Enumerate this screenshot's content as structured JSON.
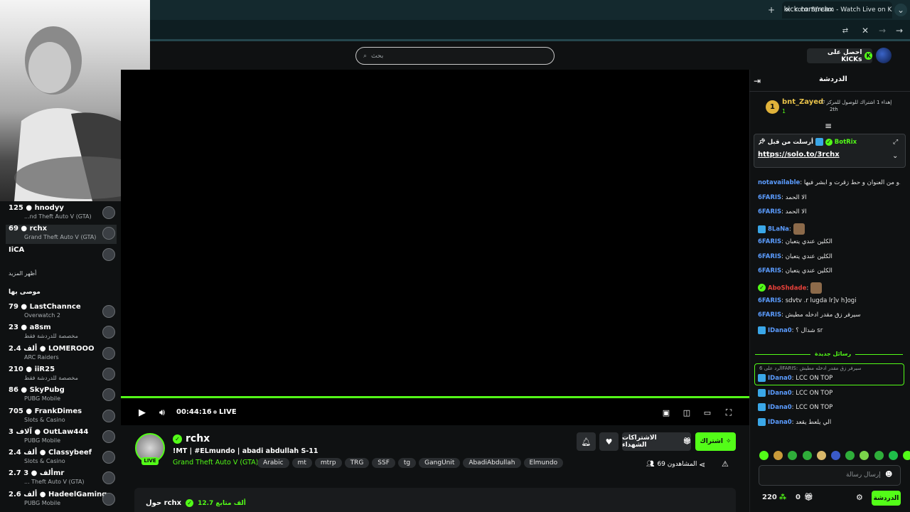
{
  "browser": {
    "tab_title": "rchx Stream - Watch Live on Kick",
    "url": "kick.com/rchx"
  },
  "header": {
    "search_placeholder": "بحث",
    "kicks_label": "احصل على KICKs"
  },
  "sidebar": {
    "channels": [
      {
        "name": "125 ● hnodyy",
        "game": "...nd Theft Auto V (GTA)"
      },
      {
        "name": "69 ● rchx",
        "game": "Grand Theft Auto V (GTA)"
      },
      {
        "name": "IiCA",
        "game": ""
      }
    ],
    "show_more": "أظهر المزيد",
    "recommended_title": "موصى بها",
    "recommended": [
      {
        "name": "79 ● LastChannce",
        "game": "Overwatch 2"
      },
      {
        "name": "23 ● a8sm",
        "game": "مخصصة للدردشة فقط"
      },
      {
        "name": "2.4 ألف ● LOMEROOO",
        "game": "ARC Raiders"
      },
      {
        "name": "210 ● iiR25",
        "game": "مخصصة للدردشة فقط"
      },
      {
        "name": "86 ● SkyPubg",
        "game": "PUBG Mobile"
      },
      {
        "name": "705 ● FrankDimes",
        "game": "Slots & Casino"
      },
      {
        "name": "3 آلاف ● OutLaw444",
        "game": "PUBG Mobile"
      },
      {
        "name": "2.4 ألف ● Classybeef",
        "game": "Slots & Casino"
      },
      {
        "name": "2.7 ألف ● 3mr",
        "game": "... Theft Auto V (GTA)"
      },
      {
        "name": "2.6 ألف ● HadeelGaming",
        "game": "PUBG Mobile"
      }
    ]
  },
  "player": {
    "time": "00:44:16",
    "live_label": "LIVE"
  },
  "stream": {
    "channel": "rchx",
    "title": "!MT | #ELmundo | abadi abdullah S-11",
    "game": "Grand Theft Auto V (GTA)",
    "tags": [
      "Arabic",
      "mt",
      "mtrp",
      "TRG",
      "SSF",
      "tg",
      "GangUnit",
      "AbadiAbdullah",
      "Elmundo"
    ],
    "live_badge": "LIVE",
    "subscribe_label": "اشتراك",
    "gift_label": "الاشتراكات الشهداء",
    "viewers": "69 المشاهدون",
    "about_title": "حول rchx",
    "followers": "12.7 ألف متابع"
  },
  "chat": {
    "title": "الدردشة",
    "top_gifter": {
      "name": "bnt_Zayed",
      "rank": "1",
      "count": "1",
      "note": "إهداء 1 اشتراك للوصول للمركز",
      "ago": "2th"
    },
    "pinned": {
      "by": "BotRix",
      "label": "أرسلت من قبل",
      "link": "https://solo.to/3rchx"
    },
    "messages": [
      {
        "user": "notavailable",
        "text": "احذف اسم الموندو من العنوان و حط زقرت و ابشر فيها",
        "color": "#5b9cff"
      },
      {
        "user": "6FARIS",
        "text": "الا الحمد",
        "color": "#5b9cff"
      },
      {
        "user": "6FARIS",
        "text": "الا الحمد",
        "color": "#5b9cff"
      },
      {
        "user": "8LaNa",
        "text": "",
        "color": "#5b9cff"
      },
      {
        "user": "6FARIS",
        "text": "الكلين عندي يتعبان",
        "color": "#5b9cff"
      },
      {
        "user": "6FARIS",
        "text": "الكلين عندي يتعبان",
        "color": "#5b9cff"
      },
      {
        "user": "6FARIS",
        "text": "الكلين عندي يتعبان",
        "color": "#5b9cff"
      },
      {
        "user": "AboShdade",
        "text": "",
        "color": "#e8413a"
      },
      {
        "user": "6FARIS",
        "text": "sdvtv .r lugda lr]v h]ogi",
        "color": "#5b9cff"
      },
      {
        "user": "6FARIS",
        "text": "سيرفر زق مقدر ادخله مطيش",
        "color": "#5b9cff"
      },
      {
        "user": "IDana0",
        "text": "شدال ؟ sr",
        "color": "#5b9cff"
      }
    ],
    "new_messages_label": "رسائل جديدة",
    "reply_context": "الرد على 6FARIS: سيرفر زق مقدر ادخله مطيش",
    "new_messages": [
      {
        "user": "IDana0",
        "text": "LCC ON TOP"
      },
      {
        "user": "IDana0",
        "text": "LCC ON TOP"
      },
      {
        "user": "IDana0",
        "text": "LCC ON TOP"
      },
      {
        "user": "IDana0",
        "text": "الي يلعط يقعد"
      }
    ],
    "input_placeholder": "إرسال رسالة",
    "points": "220",
    "gifts_count": "0",
    "send_label": "الدردشة"
  },
  "colors": {
    "accent": "#53fc18"
  }
}
